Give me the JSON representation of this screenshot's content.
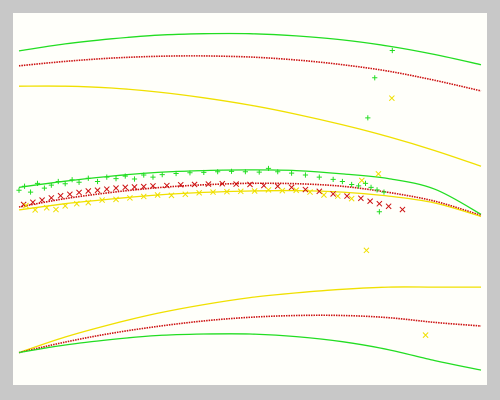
{
  "chart_data": {
    "type": "scatter",
    "title": "",
    "xlabel": "",
    "ylabel": "",
    "grid": false,
    "legend": "none",
    "xlim": [
      0,
      1
    ],
    "ylim": [
      0,
      1
    ],
    "colors": {
      "green": "#22dd22",
      "red": "#cc1111",
      "yellow": "#f0e000",
      "background": "#fffffa",
      "frame": "#c8c8c8"
    },
    "series": [
      {
        "color": "green",
        "kind": "curve",
        "x": [
          0,
          0.1,
          0.2,
          0.3,
          0.4,
          0.5,
          0.6,
          0.7,
          0.8,
          0.9,
          1.0
        ],
        "y": [
          0.907,
          0.926,
          0.94,
          0.95,
          0.954,
          0.954,
          0.948,
          0.937,
          0.92,
          0.897,
          0.869
        ]
      },
      {
        "color": "red",
        "kind": "curve",
        "x": [
          0,
          0.1,
          0.2,
          0.3,
          0.4,
          0.5,
          0.6,
          0.7,
          0.8,
          0.9,
          1.0
        ],
        "y": [
          0.866,
          0.878,
          0.887,
          0.892,
          0.893,
          0.89,
          0.882,
          0.869,
          0.851,
          0.826,
          0.797
        ]
      },
      {
        "color": "yellow",
        "kind": "curve",
        "x": [
          0,
          0.1,
          0.2,
          0.3,
          0.4,
          0.5,
          0.6,
          0.7,
          0.8,
          0.9,
          1.0
        ],
        "y": [
          0.81,
          0.81,
          0.805,
          0.794,
          0.778,
          0.758,
          0.733,
          0.704,
          0.671,
          0.633,
          0.59
        ]
      },
      {
        "color": "green",
        "kind": "curve",
        "x": [
          0,
          0.1,
          0.2,
          0.3,
          0.4,
          0.5,
          0.6,
          0.7,
          0.8,
          0.9,
          1.0
        ],
        "y": [
          0.532,
          0.549,
          0.563,
          0.573,
          0.578,
          0.58,
          0.578,
          0.569,
          0.556,
          0.527,
          0.458
        ]
      },
      {
        "color": "red",
        "kind": "curve",
        "x": [
          0,
          0.1,
          0.2,
          0.3,
          0.4,
          0.5,
          0.6,
          0.7,
          0.8,
          0.9,
          1.0
        ],
        "y": [
          0.478,
          0.501,
          0.518,
          0.531,
          0.539,
          0.543,
          0.542,
          0.535,
          0.518,
          0.494,
          0.455
        ]
      },
      {
        "color": "yellow",
        "kind": "curve",
        "x": [
          0,
          0.1,
          0.2,
          0.3,
          0.4,
          0.5,
          0.6,
          0.7,
          0.8,
          0.9,
          1.0
        ],
        "y": [
          0.47,
          0.487,
          0.5,
          0.511,
          0.518,
          0.522,
          0.523,
          0.519,
          0.508,
          0.489,
          0.452
        ]
      },
      {
        "color": "yellow",
        "kind": "curve",
        "x": [
          0,
          0.1,
          0.2,
          0.3,
          0.4,
          0.5,
          0.6,
          0.7,
          0.8,
          0.9,
          1.0
        ],
        "y": [
          0.078,
          0.121,
          0.156,
          0.186,
          0.21,
          0.229,
          0.242,
          0.252,
          0.258,
          0.258,
          0.258
        ]
      },
      {
        "color": "red",
        "kind": "curve",
        "x": [
          0,
          0.1,
          0.2,
          0.3,
          0.4,
          0.5,
          0.6,
          0.7,
          0.8,
          0.9,
          1.0
        ],
        "y": [
          0.078,
          0.107,
          0.131,
          0.15,
          0.165,
          0.175,
          0.18,
          0.18,
          0.174,
          0.161,
          0.151
        ]
      },
      {
        "color": "green",
        "kind": "curve",
        "x": [
          0,
          0.1,
          0.2,
          0.3,
          0.4,
          0.5,
          0.6,
          0.7,
          0.8,
          0.9,
          1.0
        ],
        "y": [
          0.078,
          0.099,
          0.114,
          0.125,
          0.129,
          0.129,
          0.122,
          0.108,
          0.086,
          0.056,
          0.03
        ]
      },
      {
        "color": "green",
        "kind": "points",
        "marker": "plus",
        "x": [
          0.0,
          0.012,
          0.025,
          0.04,
          0.055,
          0.07,
          0.085,
          0.1,
          0.115,
          0.13,
          0.15,
          0.17,
          0.19,
          0.21,
          0.23,
          0.25,
          0.27,
          0.29,
          0.31,
          0.34,
          0.37,
          0.4,
          0.43,
          0.46,
          0.49,
          0.52,
          0.54,
          0.56,
          0.59,
          0.62,
          0.65,
          0.68,
          0.7,
          0.72,
          0.735,
          0.75,
          0.762,
          0.775,
          0.79,
          0.808,
          0.77,
          0.755,
          0.78
        ],
        "y": [
          0.524,
          0.535,
          0.519,
          0.543,
          0.53,
          0.538,
          0.548,
          0.542,
          0.553,
          0.546,
          0.557,
          0.548,
          0.56,
          0.556,
          0.563,
          0.555,
          0.566,
          0.56,
          0.567,
          0.57,
          0.572,
          0.573,
          0.575,
          0.576,
          0.575,
          0.574,
          0.584,
          0.575,
          0.571,
          0.566,
          0.56,
          0.554,
          0.548,
          0.54,
          0.536,
          0.543,
          0.532,
          0.525,
          0.519,
          0.908,
          0.833,
          0.723,
          0.465
        ]
      },
      {
        "color": "red",
        "kind": "points",
        "marker": "x",
        "x": [
          0.01,
          0.03,
          0.05,
          0.07,
          0.09,
          0.11,
          0.13,
          0.15,
          0.17,
          0.19,
          0.21,
          0.23,
          0.25,
          0.27,
          0.29,
          0.32,
          0.35,
          0.38,
          0.41,
          0.44,
          0.47,
          0.5,
          0.53,
          0.56,
          0.59,
          0.62,
          0.65,
          0.68,
          0.71,
          0.74,
          0.76,
          0.78,
          0.8,
          0.83
        ],
        "y": [
          0.485,
          0.491,
          0.497,
          0.503,
          0.509,
          0.513,
          0.518,
          0.522,
          0.524,
          0.527,
          0.53,
          0.532,
          0.533,
          0.534,
          0.536,
          0.537,
          0.539,
          0.54,
          0.541,
          0.542,
          0.541,
          0.54,
          0.537,
          0.535,
          0.532,
          0.526,
          0.521,
          0.514,
          0.508,
          0.502,
          0.494,
          0.487,
          0.48,
          0.471
        ]
      },
      {
        "color": "yellow",
        "kind": "points",
        "marker": "x",
        "x": [
          0.015,
          0.035,
          0.06,
          0.08,
          0.1,
          0.125,
          0.15,
          0.18,
          0.21,
          0.24,
          0.27,
          0.3,
          0.33,
          0.36,
          0.39,
          0.42,
          0.45,
          0.48,
          0.51,
          0.54,
          0.57,
          0.6,
          0.63,
          0.66,
          0.69,
          0.72,
          0.742,
          0.752,
          0.778,
          0.807,
          0.88
        ],
        "y": [
          0.482,
          0.47,
          0.476,
          0.471,
          0.481,
          0.487,
          0.49,
          0.497,
          0.499,
          0.503,
          0.507,
          0.511,
          0.51,
          0.513,
          0.517,
          0.519,
          0.52,
          0.521,
          0.522,
          0.525,
          0.523,
          0.524,
          0.519,
          0.511,
          0.508,
          0.501,
          0.551,
          0.359,
          0.569,
          0.777,
          0.126
        ]
      }
    ]
  }
}
